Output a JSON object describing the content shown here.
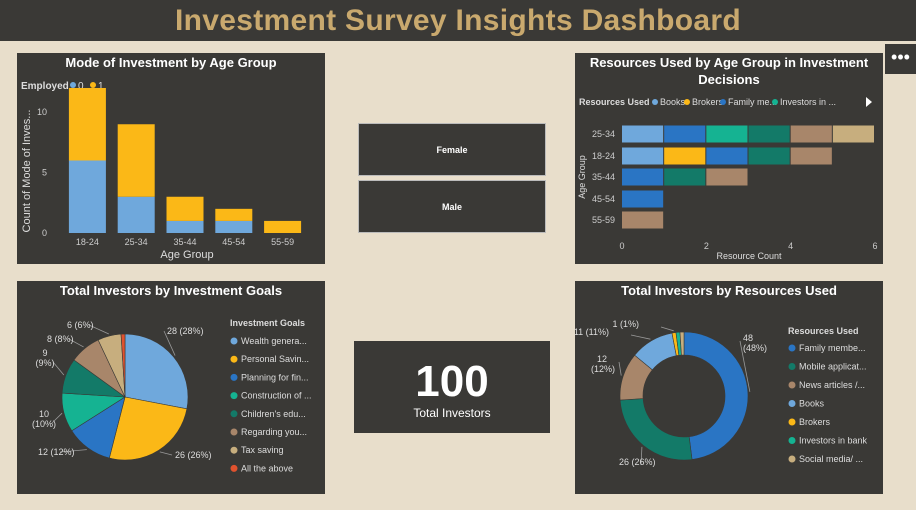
{
  "dashboard_title": "Investment Survey Insights Dashboard",
  "more_options_label": "•••",
  "slicer": {
    "female": "Female",
    "male": "Male"
  },
  "card": {
    "value": "100",
    "label": "Total Investors"
  },
  "colors": {
    "panel": "#3a3936",
    "background": "#e8decb",
    "title": "#c9a96e"
  },
  "chart_data": [
    {
      "id": "age_mode",
      "type": "bar",
      "title": "Mode of Investment by Age Group",
      "xlabel": "Age Group",
      "ylabel": "Count of Mode of Inves...",
      "legend_title": "Employed",
      "categories": [
        "18-24",
        "25-34",
        "35-44",
        "45-54",
        "55-59"
      ],
      "series": [
        {
          "name": "0",
          "color": "#6fa8dc",
          "values": [
            6,
            3,
            1,
            1,
            0
          ]
        },
        {
          "name": "1",
          "color": "#fbb817",
          "values": [
            6,
            6,
            2,
            1,
            1
          ]
        }
      ],
      "ylim": [
        0,
        12
      ],
      "yticks": [
        0,
        5,
        10
      ],
      "stacked": true
    },
    {
      "id": "resources_age",
      "type": "bar",
      "orientation": "horizontal",
      "title": "Resources Used by Age Group in Investment Decisions",
      "xlabel": "Resource Count",
      "ylabel": "Age Group",
      "legend_title": "Resources Used",
      "legend_labels": [
        "Books",
        "Brokers",
        "Family me...",
        "Investors in ..."
      ],
      "categories": [
        "25-34",
        "18-24",
        "35-44",
        "45-54",
        "55-59"
      ],
      "series": [
        {
          "name": "Books",
          "color": "#6fa8dc",
          "values": [
            1,
            1,
            0,
            0,
            0
          ]
        },
        {
          "name": "Brokers",
          "color": "#fbb817",
          "values": [
            0,
            1,
            0,
            0,
            0
          ]
        },
        {
          "name": "Family members",
          "color": "#2a75c4",
          "values": [
            1,
            1,
            1,
            1,
            0
          ]
        },
        {
          "name": "Investors in bank",
          "color": "#15b392",
          "values": [
            1,
            0,
            0,
            0,
            0
          ]
        },
        {
          "name": "Mobile applications",
          "color": "#137a68",
          "values": [
            1,
            1,
            1,
            0,
            0
          ]
        },
        {
          "name": "News articles",
          "color": "#a8866a",
          "values": [
            1,
            1,
            1,
            0,
            1
          ]
        },
        {
          "name": "Social media",
          "color": "#c7ae7e",
          "values": [
            1,
            0,
            0,
            0,
            0
          ]
        }
      ],
      "xlim": [
        0,
        6
      ],
      "xticks": [
        0,
        2,
        4,
        6
      ],
      "stacked": true
    },
    {
      "id": "goals_pie",
      "type": "pie",
      "title": "Total Investors by Investment Goals",
      "legend_title": "Investment Goals",
      "legend_labels": [
        "Wealth genera...",
        "Personal Savin...",
        "Planning for fin...",
        "Construction of ...",
        "Children's edu...",
        "Regarding you...",
        "Tax saving",
        "All the above"
      ],
      "slices": [
        {
          "value": 28,
          "color": "#6fa8dc",
          "label": "28 (28%)"
        },
        {
          "value": 26,
          "color": "#fbb817",
          "label": "26 (26%)"
        },
        {
          "value": 12,
          "color": "#2a75c4",
          "label": "12 (12%)"
        },
        {
          "value": 10,
          "color": "#15b392",
          "label": "10 (10%)"
        },
        {
          "value": 9,
          "color": "#137a68",
          "label": "9 (9%)"
        },
        {
          "value": 8,
          "color": "#a8866a",
          "label": "8 (8%)"
        },
        {
          "value": 6,
          "color": "#c7ae7e",
          "label": "6 (6%)"
        },
        {
          "value": 1,
          "color": "#e0522e",
          "label": ""
        }
      ]
    },
    {
      "id": "resources_donut",
      "type": "pie",
      "donut": true,
      "title": "Total Investors by Resources Used",
      "legend_title": "Resources Used",
      "legend_labels": [
        "Family membe...",
        "Mobile applicat...",
        "News articles /...",
        "Books",
        "Brokers",
        "Investors in bank",
        "Social media/ ..."
      ],
      "slices": [
        {
          "value": 48,
          "color": "#2a75c4",
          "label": "48 (48%)"
        },
        {
          "value": 26,
          "color": "#137a68",
          "label": "26 (26%)"
        },
        {
          "value": 12,
          "color": "#a8866a",
          "label": "12 (12%)"
        },
        {
          "value": 11,
          "color": "#6fa8dc",
          "label": "11 (11%)"
        },
        {
          "value": 1,
          "color": "#fbb817",
          "label": "1 (1%)"
        },
        {
          "value": 1,
          "color": "#15b392",
          "label": ""
        },
        {
          "value": 1,
          "color": "#c7ae7e",
          "label": ""
        }
      ]
    }
  ]
}
